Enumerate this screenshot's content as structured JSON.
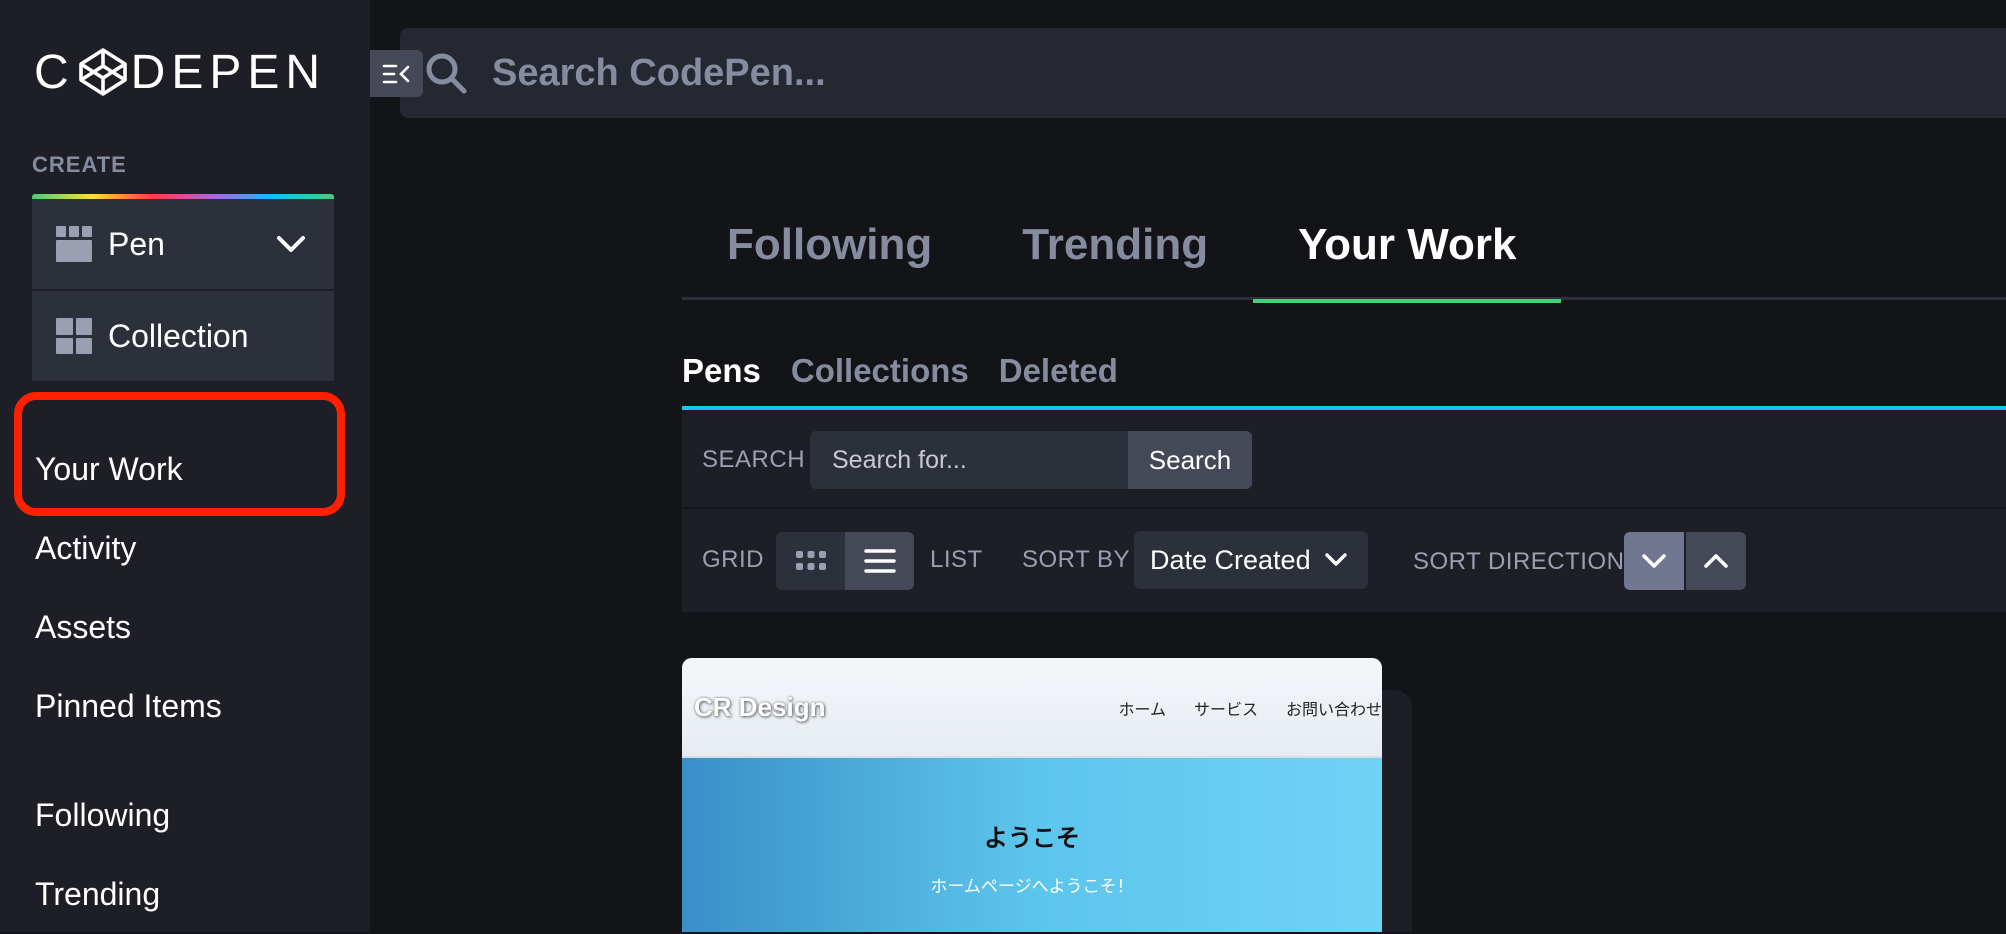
{
  "sidebar": {
    "logo_text_left": "C",
    "logo_text_right": "DEPEN",
    "create_label": "CREATE",
    "create_items": [
      {
        "label": "Pen"
      },
      {
        "label": "Collection"
      }
    ],
    "nav_items": [
      {
        "label": "Your Work"
      },
      {
        "label": "Activity"
      },
      {
        "label": "Assets"
      },
      {
        "label": "Pinned Items"
      },
      {
        "label": "Following"
      },
      {
        "label": "Trending"
      }
    ]
  },
  "topbar": {
    "search_placeholder": "Search CodePen..."
  },
  "main_tabs": [
    {
      "label": "Following"
    },
    {
      "label": "Trending"
    },
    {
      "label": "Your Work",
      "active": true
    }
  ],
  "sub_tabs": [
    {
      "label": "Pens",
      "active": true
    },
    {
      "label": "Collections"
    },
    {
      "label": "Deleted"
    }
  ],
  "filters": {
    "search_label": "SEARCH",
    "search_placeholder": "Search for...",
    "search_button": "Search",
    "grid_label": "GRID",
    "list_label": "LIST",
    "sort_by_label": "SORT BY",
    "sort_by_value": "Date Created",
    "sort_direction_label": "SORT DIRECTION"
  },
  "pen_card": {
    "brand": "CR Design",
    "nav": [
      "ホーム",
      "サービス",
      "お問い合わせ"
    ],
    "welcome": "ようこそ",
    "subtitle": "ホームページへようこそ！"
  },
  "colors": {
    "highlight": "#ff2000",
    "active_tab_underline": "#47cf73",
    "subtab_underline": "#1ac2e6"
  }
}
